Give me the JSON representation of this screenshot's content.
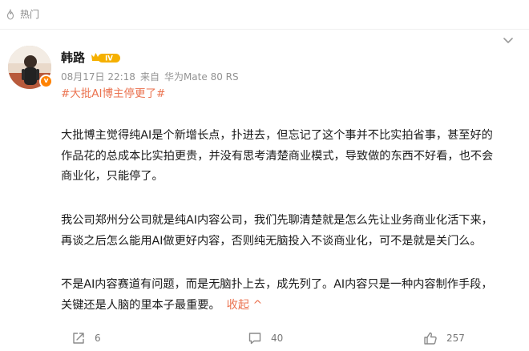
{
  "feed": {
    "section_label": "热门"
  },
  "post": {
    "author": {
      "name": "韩路",
      "level": "IV",
      "verified_mark": "v"
    },
    "meta": {
      "date": "08月17日 22:18",
      "source_prefix": "来自",
      "device": "华为Mate 80 RS"
    },
    "topic": "#大批AI博主停更了#",
    "paragraphs": [
      {
        "lines": [
          "大批博主觉得纯AI是个新增长点，扑进去，但忘记了这个事并不比实拍省事，甚至好的",
          "作品花的总成本比实拍更贵，并没有思考清楚商业模式，导致做的东西不好看，也不会",
          "商业化，只能停了。"
        ]
      },
      {
        "lines": [
          "我公司郑州分公司就是纯AI内容公司，我们先聊清楚就是怎么先让业务商业化活下来，",
          "再谈之后怎么能用AI做更好内容，否则纯无脑投入不谈商业化，可不是就是关门么。"
        ]
      },
      {
        "lines": [
          "不是AI内容赛道有问题，而是无脑扑上去，成先列了。AI内容只是一种内容制作手段，",
          "关键还是人脑的里本子最重要。"
        ],
        "collapse_label": "收起 ^"
      }
    ],
    "actions": {
      "share_count": "6",
      "comment_count": "40",
      "like_count": "257"
    }
  },
  "colors": {
    "accent": "#eb7350",
    "muted": "#939393",
    "verified": "#ff8200",
    "level_gold": "#f5b000"
  },
  "icons": {
    "hot": "fire-icon",
    "more": "chevron-down-icon",
    "share": "share-icon",
    "comment": "comment-icon",
    "like": "thumbs-up-icon"
  }
}
